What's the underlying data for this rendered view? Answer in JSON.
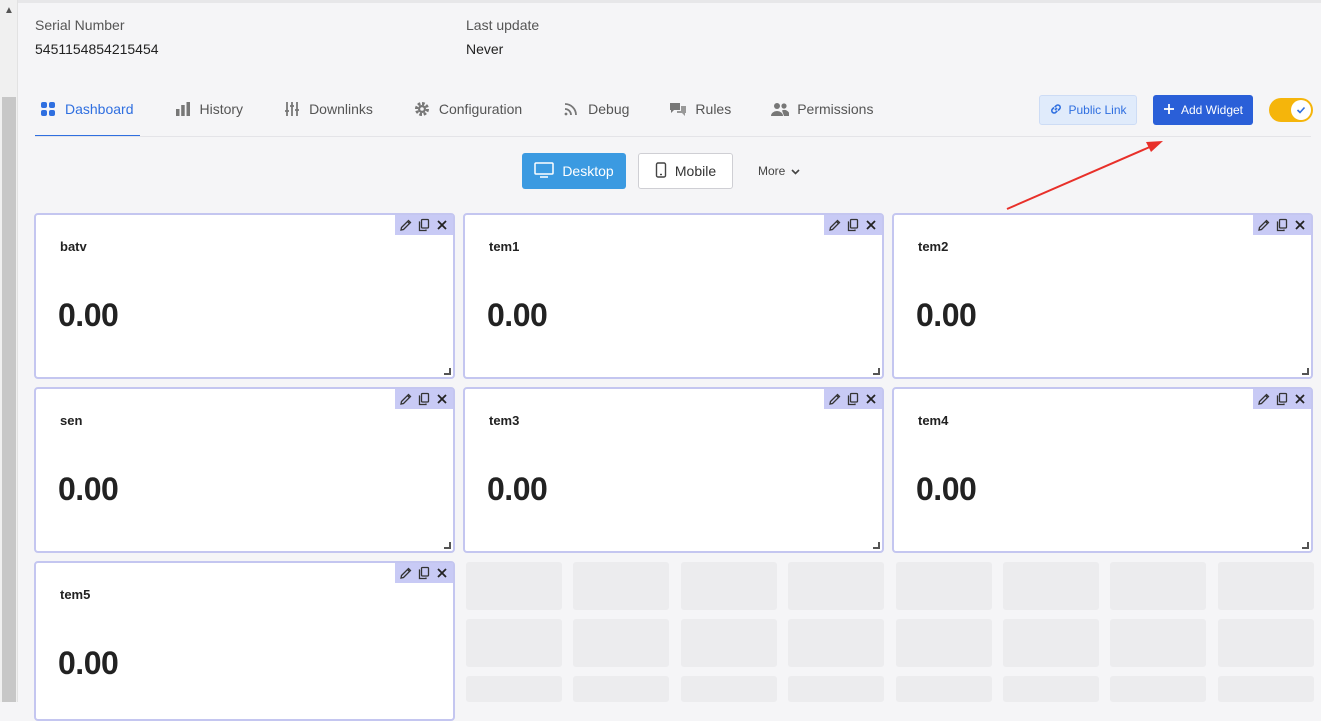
{
  "device": {
    "serial_label": "Serial Number",
    "serial_value": "5451154854215454",
    "update_label": "Last update",
    "update_value": "Never"
  },
  "tabs": [
    {
      "label": "Dashboard",
      "icon": "grid-icon"
    },
    {
      "label": "History",
      "icon": "bar-chart-icon"
    },
    {
      "label": "Downlinks",
      "icon": "sliders-icon"
    },
    {
      "label": "Configuration",
      "icon": "gear-icon"
    },
    {
      "label": "Debug",
      "icon": "rss-icon"
    },
    {
      "label": "Rules",
      "icon": "chat-icon"
    },
    {
      "label": "Permissions",
      "icon": "users-icon"
    }
  ],
  "actions": {
    "public_link": "Public Link",
    "add_widget": "Add Widget",
    "edit_mode_on": true
  },
  "view": {
    "desktop": "Desktop",
    "mobile": "Mobile",
    "more": "More"
  },
  "widgets": [
    {
      "title": "batv",
      "value": "0.00"
    },
    {
      "title": "tem1",
      "value": "0.00"
    },
    {
      "title": "tem2",
      "value": "0.00"
    },
    {
      "title": "sen",
      "value": "0.00"
    },
    {
      "title": "tem3",
      "value": "0.00"
    },
    {
      "title": "tem4",
      "value": "0.00"
    },
    {
      "title": "tem5",
      "value": "0.00"
    }
  ],
  "colors": {
    "accent": "#2f6fe0",
    "add_button": "#2a5fd8",
    "desktop_button": "#3b9ae1",
    "toggle": "#f5b50b",
    "widget_border": "#c4c6f0",
    "annotation_arrow": "#e8302a"
  }
}
